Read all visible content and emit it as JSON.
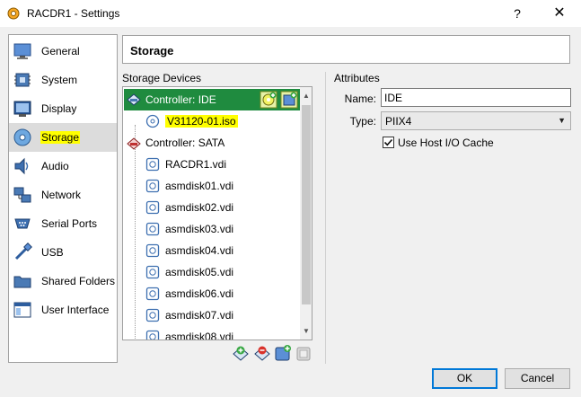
{
  "window": {
    "title": "RACDR1 - Settings",
    "help": "?",
    "close": "✕"
  },
  "nav": {
    "items": [
      {
        "label": "General"
      },
      {
        "label": "System"
      },
      {
        "label": "Display"
      },
      {
        "label": "Storage"
      },
      {
        "label": "Audio"
      },
      {
        "label": "Network"
      },
      {
        "label": "Serial Ports"
      },
      {
        "label": "USB"
      },
      {
        "label": "Shared Folders"
      },
      {
        "label": "User Interface"
      }
    ],
    "selected": "Storage"
  },
  "section": {
    "title": "Storage"
  },
  "storage_devices": {
    "label": "Storage Devices",
    "rows": [
      {
        "label": "Controller: IDE"
      },
      {
        "label": "V31120-01.iso"
      },
      {
        "label": "Controller: SATA"
      },
      {
        "label": "RACDR1.vdi"
      },
      {
        "label": "asmdisk01.vdi"
      },
      {
        "label": "asmdisk02.vdi"
      },
      {
        "label": "asmdisk03.vdi"
      },
      {
        "label": "asmdisk04.vdi"
      },
      {
        "label": "asmdisk05.vdi"
      },
      {
        "label": "asmdisk06.vdi"
      },
      {
        "label": "asmdisk07.vdi"
      },
      {
        "label": "asmdisk08.vdi"
      }
    ]
  },
  "attributes": {
    "label": "Attributes",
    "name_label": "Name:",
    "name_value": "IDE",
    "type_label": "Type:",
    "type_value": "PIIX4",
    "host_io_cache_label": "Use Host I/O Cache",
    "host_io_cache_checked": true
  },
  "buttons": {
    "ok": "OK",
    "cancel": "Cancel"
  },
  "colors": {
    "selection": "#1f8b3f",
    "highlight": "#ffff00",
    "ok_border": "#0078d7"
  }
}
